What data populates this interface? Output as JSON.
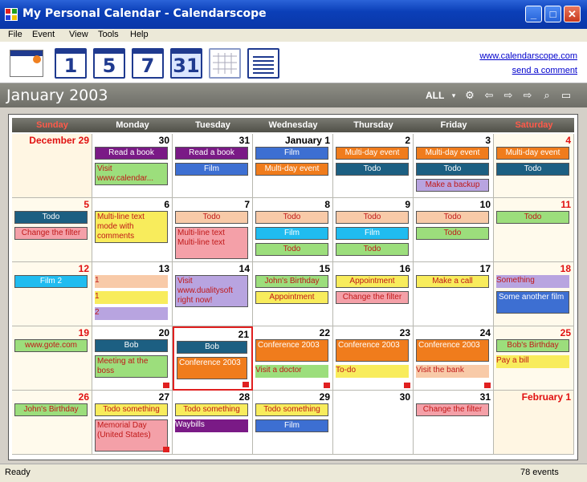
{
  "window": {
    "title": "My Personal Calendar - Calendarscope"
  },
  "menu": [
    "File",
    "Event",
    "View",
    "Tools",
    "Help"
  ],
  "toolbar": {
    "buttons": [
      "1",
      "5",
      "7",
      "31"
    ],
    "link_site": "www.calendarscope.com",
    "link_comment": "send a comment"
  },
  "header": {
    "month_title": "January 2003",
    "filter_label": "ALL"
  },
  "weekdays": [
    "Sunday",
    "Monday",
    "Tuesday",
    "Wednesday",
    "Thursday",
    "Friday",
    "Saturday"
  ],
  "colors": {
    "purple": "#7a1a86",
    "blue": "#3d6fd2",
    "orange": "#f07c1c",
    "teal": "#1c5f82",
    "lightpurple": "#b8a4e0",
    "green": "#9cde7c",
    "yellow": "#f8ec5c",
    "peach": "#f8caa8",
    "pink": "#f4a0a8",
    "cyan": "#20bcf0",
    "red": "#e02020"
  },
  "weeks": [
    [
      {
        "label": "December 29",
        "events": []
      },
      {
        "label": "30",
        "events": [
          {
            "text": "Read a book",
            "color": "purple"
          },
          {
            "text": "Visit www.calendar...",
            "color": "green",
            "multi": true
          }
        ]
      },
      {
        "label": "31",
        "events": [
          {
            "text": "Read a book",
            "color": "purple"
          },
          {
            "text": "Film",
            "color": "blue"
          }
        ]
      },
      {
        "label": "January 1",
        "events": [
          {
            "text": "Film",
            "color": "blue"
          },
          {
            "text": "Multi-day event",
            "color": "orange"
          }
        ]
      },
      {
        "label": "2",
        "events": [
          {
            "text": "Multi-day event",
            "color": "orange"
          },
          {
            "text": "Todo",
            "color": "teal"
          }
        ]
      },
      {
        "label": "3",
        "events": [
          {
            "text": "Multi-day event",
            "color": "orange"
          },
          {
            "text": "Todo",
            "color": "teal"
          },
          {
            "text": "Make a backup",
            "color": "lightpurple"
          }
        ]
      },
      {
        "label": "4",
        "events": [
          {
            "text": "Multi-day event",
            "color": "orange"
          },
          {
            "text": "Todo",
            "color": "teal"
          }
        ]
      }
    ],
    [
      {
        "label": "5",
        "events": [
          {
            "text": "Todo",
            "color": "teal"
          },
          {
            "text": "Change the filter",
            "color": "pink"
          }
        ]
      },
      {
        "label": "6",
        "events": [
          {
            "text": "Multi-line text mode with comments",
            "color": "yellow",
            "multi": true
          }
        ]
      },
      {
        "label": "7",
        "events": [
          {
            "text": "Todo",
            "color": "peach"
          },
          {
            "text": "Multi-line text Multi-line text",
            "color": "pink",
            "multi": true
          }
        ]
      },
      {
        "label": "8",
        "events": [
          {
            "text": "Todo",
            "color": "peach"
          },
          {
            "text": "Film",
            "color": "cyan"
          },
          {
            "text": "Todo",
            "color": "green"
          }
        ]
      },
      {
        "label": "9",
        "events": [
          {
            "text": "Todo",
            "color": "peach"
          },
          {
            "text": "Film",
            "color": "cyan"
          },
          {
            "text": "Todo",
            "color": "green"
          }
        ]
      },
      {
        "label": "10",
        "events": [
          {
            "text": "Todo",
            "color": "peach"
          },
          {
            "text": "Todo",
            "color": "green"
          }
        ]
      },
      {
        "label": "11",
        "events": [
          {
            "text": "Todo",
            "color": "green"
          }
        ]
      }
    ],
    [
      {
        "label": "12",
        "events": [
          {
            "text": "Film 2",
            "color": "cyan"
          }
        ]
      },
      {
        "label": "13",
        "events": [
          {
            "text": "1",
            "color": "peach",
            "plain": true
          },
          {
            "text": "1",
            "color": "yellow",
            "plain": true
          },
          {
            "text": "2",
            "color": "lightpurple",
            "plain": true
          }
        ]
      },
      {
        "label": "14",
        "events": [
          {
            "text": "Visit www.dualitysoft right now!",
            "color": "lightpurple",
            "multi": true
          }
        ]
      },
      {
        "label": "15",
        "events": [
          {
            "text": "John's Birthday",
            "color": "green"
          },
          {
            "text": "Appointment",
            "color": "yellow"
          }
        ]
      },
      {
        "label": "16",
        "events": [
          {
            "text": "Appointment",
            "color": "yellow"
          },
          {
            "text": "Change the filter",
            "color": "pink"
          }
        ]
      },
      {
        "label": "17",
        "events": [
          {
            "text": "Make a call",
            "color": "yellow"
          }
        ]
      },
      {
        "label": "18",
        "events": [
          {
            "text": "Something",
            "color": "lightpurple",
            "plain": true
          },
          {
            "text": "Some another film",
            "color": "blue",
            "multi": true
          }
        ]
      }
    ],
    [
      {
        "label": "19",
        "events": [
          {
            "text": "www.gote.com",
            "color": "green"
          }
        ]
      },
      {
        "label": "20",
        "events": [
          {
            "text": "Bob",
            "color": "teal"
          },
          {
            "text": "Meeting at the boss",
            "color": "green",
            "multi": true
          }
        ],
        "more": true
      },
      {
        "label": "21",
        "events": [
          {
            "text": "Bob",
            "color": "teal"
          },
          {
            "text": "Conference 2003",
            "color": "orange",
            "multi": true
          }
        ],
        "more": true,
        "selected": true
      },
      {
        "label": "22",
        "events": [
          {
            "text": "Conference 2003",
            "color": "orange",
            "multi": true
          },
          {
            "text": "Visit a doctor",
            "color": "green",
            "plain": true
          }
        ],
        "more": true
      },
      {
        "label": "23",
        "events": [
          {
            "text": "Conference 2003",
            "color": "orange",
            "multi": true
          },
          {
            "text": "To-do",
            "color": "yellow",
            "plain": true
          }
        ],
        "more": true
      },
      {
        "label": "24",
        "events": [
          {
            "text": "Conference 2003",
            "color": "orange",
            "multi": true
          },
          {
            "text": "Visit the bank",
            "color": "peach",
            "plain": true
          }
        ],
        "more": true
      },
      {
        "label": "25",
        "events": [
          {
            "text": "Bob's Birthday",
            "color": "green"
          },
          {
            "text": "Pay a bill",
            "color": "yellow",
            "plain": true
          }
        ]
      }
    ],
    [
      {
        "label": "26",
        "events": [
          {
            "text": "John's Birthday",
            "color": "green"
          }
        ]
      },
      {
        "label": "27",
        "events": [
          {
            "text": "Todo something",
            "color": "yellow"
          },
          {
            "text": "Memorial Day (United States)",
            "color": "pink",
            "multi": true
          }
        ],
        "more": true
      },
      {
        "label": "28",
        "events": [
          {
            "text": "Todo something",
            "color": "yellow"
          },
          {
            "text": "Waybills",
            "color": "purple",
            "plain": true
          }
        ]
      },
      {
        "label": "29",
        "events": [
          {
            "text": "Todo something",
            "color": "yellow"
          },
          {
            "text": "Film",
            "color": "blue"
          }
        ]
      },
      {
        "label": "30",
        "events": []
      },
      {
        "label": "31",
        "events": [
          {
            "text": "Change the filter",
            "color": "pink"
          }
        ]
      },
      {
        "label": "February 1",
        "events": []
      }
    ]
  ],
  "status": {
    "left": "Ready",
    "right": "78 events"
  }
}
